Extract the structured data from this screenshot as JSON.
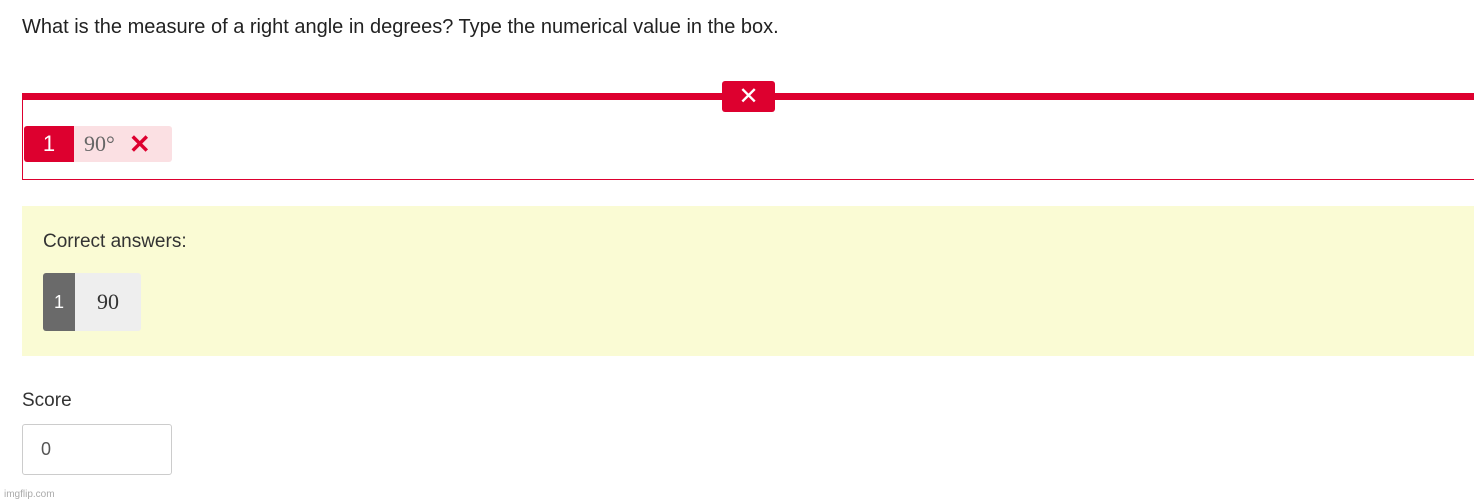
{
  "question": {
    "text": "What is the measure of a right angle in degrees? Type the numerical value in the box."
  },
  "response": {
    "status_icon": "close-icon",
    "accent_color": "#dd002f",
    "index": "1",
    "value": "90°",
    "mark_icon": "×"
  },
  "correct_answers": {
    "label": "Correct answers:",
    "items": [
      {
        "index": "1",
        "value": "90"
      }
    ],
    "background_color": "#fafbd4"
  },
  "score": {
    "label": "Score",
    "value": "0"
  },
  "watermark": "imgflip.com"
}
